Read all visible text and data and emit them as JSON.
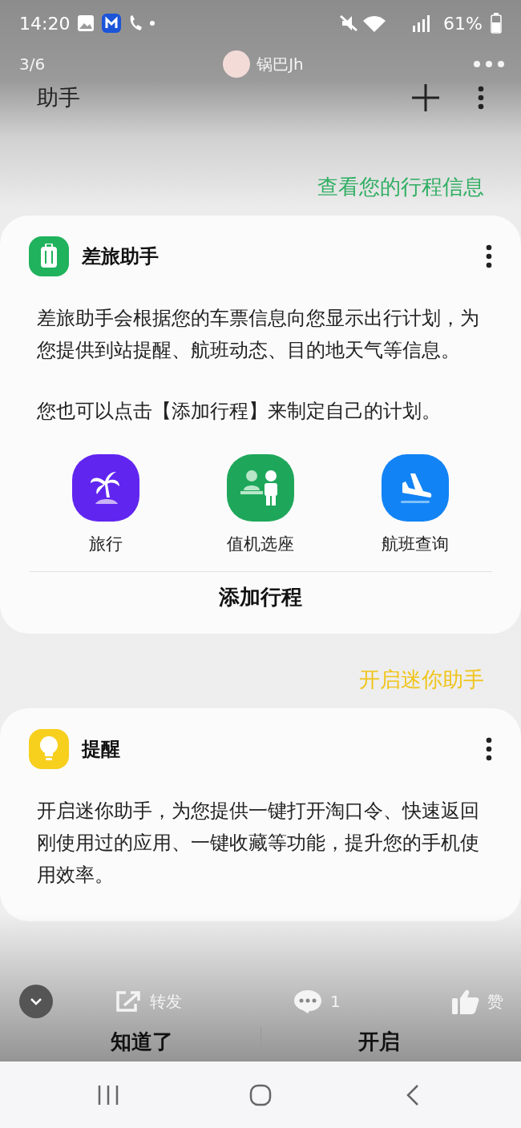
{
  "status_bar": {
    "time": "14:20",
    "battery": "61%"
  },
  "viewer": {
    "counter": "3/6",
    "author": "锅巴Jh"
  },
  "app_bar": {
    "title": "助手"
  },
  "sections": [
    {
      "link": {
        "text": "查看您的行程信息",
        "color": "#2fae62"
      },
      "card": {
        "kind": "travel",
        "title": "差旅助手",
        "paragraphs": [
          "差旅助手会根据您的车票信息向您显示出行计划，为您提供到站提醒、航班动态、目的地天气等信息。",
          "您也可以点击【添加行程】来制定自己的计划。"
        ],
        "shortcuts": [
          {
            "kind": "palm",
            "label": "旅行",
            "color": "#6125f0"
          },
          {
            "kind": "checkin",
            "label": "值机选座",
            "color": "#1ea75a"
          },
          {
            "kind": "plane",
            "label": "航班查询",
            "color": "#1183f5"
          }
        ],
        "buttons": [
          "添加行程"
        ]
      }
    },
    {
      "link": {
        "text": "开启迷你助手",
        "color": "#f0c419"
      },
      "card": {
        "kind": "reminder",
        "title": "提醒",
        "paragraphs": [
          "开启迷你助手，为您提供一键打开淘口令、快速返回刚使用过的应用、一键收藏等功能，提升您的手机使用效率。"
        ],
        "buttons": [
          "知道了",
          "开启"
        ]
      }
    }
  ],
  "viewer_actions": {
    "share": "转发",
    "comments": "1",
    "like": "赞"
  }
}
